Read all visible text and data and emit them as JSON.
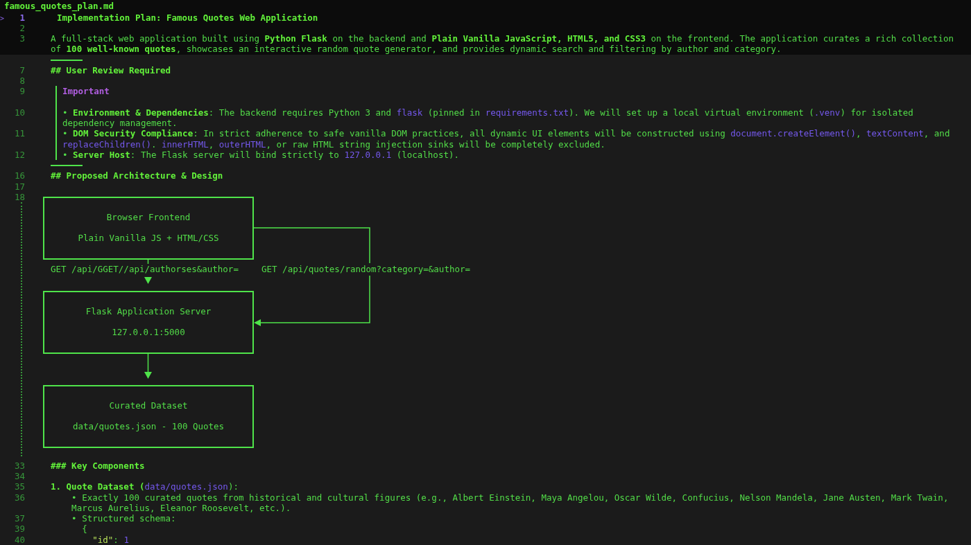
{
  "file": {
    "name": "famous_quotes_plan.md"
  },
  "header_lines": [
    {
      "kind": "title",
      "number": "1",
      "current": true,
      "marker": ">",
      "segments": [
        {
          "kind": "bold",
          "text": "Implementation Plan: Famous Quotes Web Application"
        }
      ]
    },
    {
      "kind": "text",
      "number": "2",
      "current": false
    },
    {
      "kind": "text",
      "number": "3",
      "current": false,
      "segments": [
        {
          "kind": "plain",
          "text": "A full-stack web application built using "
        },
        {
          "kind": "bold",
          "text": "Python Flask"
        },
        {
          "kind": "plain",
          "text": " on the backend and "
        },
        {
          "kind": "bold",
          "text": "Plain Vanilla JavaScript, HTML5, and CSS3"
        },
        {
          "kind": "plain",
          "text": " on the frontend. The application curates a rich collection"
        }
      ]
    },
    {
      "kind": "text",
      "segments": [
        {
          "kind": "plain",
          "text": "of "
        },
        {
          "kind": "bold",
          "text": "100 well-known quotes"
        },
        {
          "kind": "plain",
          "text": ", showcases an interactive random quote generator, and provides dynamic search and filtering by author and category."
        }
      ]
    }
  ],
  "lines": [
    {
      "kind": "rule"
    },
    {
      "kind": "heading",
      "number": "7",
      "current": false,
      "segments": [
        {
          "kind": "bold",
          "text": "## User Review Required"
        }
      ]
    },
    {
      "kind": "text",
      "number": "8",
      "current": false
    },
    {
      "kind": "callout_label",
      "number": "9",
      "current": false,
      "segments": [
        {
          "kind": "label",
          "text": "Important"
        }
      ]
    },
    {
      "kind": "callout"
    },
    {
      "kind": "callout",
      "number": "10",
      "current": false,
      "segments": [
        {
          "kind": "plain",
          "text": "• "
        },
        {
          "kind": "bold",
          "text": "Environment & Dependencies"
        },
        {
          "kind": "plain",
          "text": ": The backend requires Python 3 and "
        },
        {
          "kind": "code",
          "text": "flask"
        },
        {
          "kind": "plain",
          "text": " (pinned in "
        },
        {
          "kind": "code",
          "text": "requirements.txt"
        },
        {
          "kind": "plain",
          "text": "). We will set up a local virtual environment ("
        },
        {
          "kind": "code",
          "text": ".venv"
        },
        {
          "kind": "plain",
          "text": ") for isolated"
        }
      ]
    },
    {
      "kind": "callout",
      "segments": [
        {
          "kind": "plain",
          "text": "dependency management."
        }
      ]
    },
    {
      "kind": "callout",
      "number": "11",
      "current": false,
      "segments": [
        {
          "kind": "plain",
          "text": "• "
        },
        {
          "kind": "bold",
          "text": "DOM Security Compliance"
        },
        {
          "kind": "plain",
          "text": ": In strict adherence to safe vanilla DOM practices, all dynamic UI elements will be constructed using "
        },
        {
          "kind": "code",
          "text": "document.createElement()"
        },
        {
          "kind": "plain",
          "text": ", "
        },
        {
          "kind": "code",
          "text": "textContent"
        },
        {
          "kind": "plain",
          "text": ", and"
        }
      ]
    },
    {
      "kind": "callout",
      "segments": [
        {
          "kind": "code",
          "text": "replaceChildren()"
        },
        {
          "kind": "plain",
          "text": ". "
        },
        {
          "kind": "code",
          "text": "innerHTML"
        },
        {
          "kind": "plain",
          "text": ", "
        },
        {
          "kind": "code",
          "text": "outerHTML"
        },
        {
          "kind": "plain",
          "text": ", or raw HTML string injection sinks will be completely excluded."
        }
      ]
    },
    {
      "kind": "callout",
      "number": "12",
      "current": false,
      "segments": [
        {
          "kind": "plain",
          "text": "• "
        },
        {
          "kind": "bold",
          "text": "Server Host"
        },
        {
          "kind": "plain",
          "text": ": The Flask server will bind strictly to "
        },
        {
          "kind": "code",
          "text": "127.0.0.1"
        },
        {
          "kind": "plain",
          "text": " (localhost)."
        }
      ]
    },
    {
      "kind": "rule"
    },
    {
      "kind": "heading",
      "number": "16",
      "current": false,
      "segments": [
        {
          "kind": "bold",
          "text": "## Proposed Architecture & Design"
        }
      ]
    },
    {
      "kind": "text",
      "number": "17",
      "current": false
    },
    {
      "kind": "diagram",
      "number": "18",
      "current": false,
      "nodes": [
        {
          "title": "Browser Frontend",
          "subtitle": "Plain Vanilla JS + HTML/CSS"
        },
        {
          "title": "Flask Application Server",
          "subtitle": "127.0.0.1:5000"
        },
        {
          "title": "Curated Dataset",
          "subtitle": "data/quotes.json - 100 Quotes"
        }
      ],
      "edge_labels": [
        "GET /api/GGET//api/authorses&author=",
        "GET /api/quotes/random?category=&author="
      ]
    },
    {
      "kind": "heading",
      "number": "33",
      "current": false,
      "segments": [
        {
          "kind": "bold",
          "text": "### Key Components"
        }
      ]
    },
    {
      "kind": "text",
      "number": "34",
      "current": false
    },
    {
      "kind": "text",
      "number": "35",
      "current": false,
      "segments": [
        {
          "kind": "bold",
          "text": "1. Quote Dataset ("
        },
        {
          "kind": "code",
          "text": "data/quotes.json"
        },
        {
          "kind": "plain",
          "text": "):"
        }
      ]
    },
    {
      "kind": "text",
      "number": "36",
      "current": false,
      "segments": [
        {
          "kind": "plain",
          "text": "    • Exactly 100 curated quotes from historical and cultural figures (e.g., Albert Einstein, Maya Angelou, Oscar Wilde, Confucius, Nelson Mandela, Jane Austen, Mark Twain,"
        }
      ]
    },
    {
      "kind": "text",
      "segments": [
        {
          "kind": "plain",
          "text": "    Marcus Aurelius, Eleanor Roosevelt, etc.)."
        }
      ]
    },
    {
      "kind": "text",
      "number": "37",
      "current": false,
      "segments": [
        {
          "kind": "plain",
          "text": "    • Structured schema:"
        }
      ]
    },
    {
      "kind": "text",
      "number": "39",
      "current": false,
      "segments": [
        {
          "kind": "plain",
          "text": "      {"
        }
      ]
    },
    {
      "kind": "text",
      "number": "40",
      "current": false,
      "segments": [
        {
          "kind": "key",
          "text": "        \"id\""
        },
        {
          "kind": "plain",
          "text": ": "
        },
        {
          "kind": "code",
          "text": "1"
        }
      ]
    }
  ]
}
